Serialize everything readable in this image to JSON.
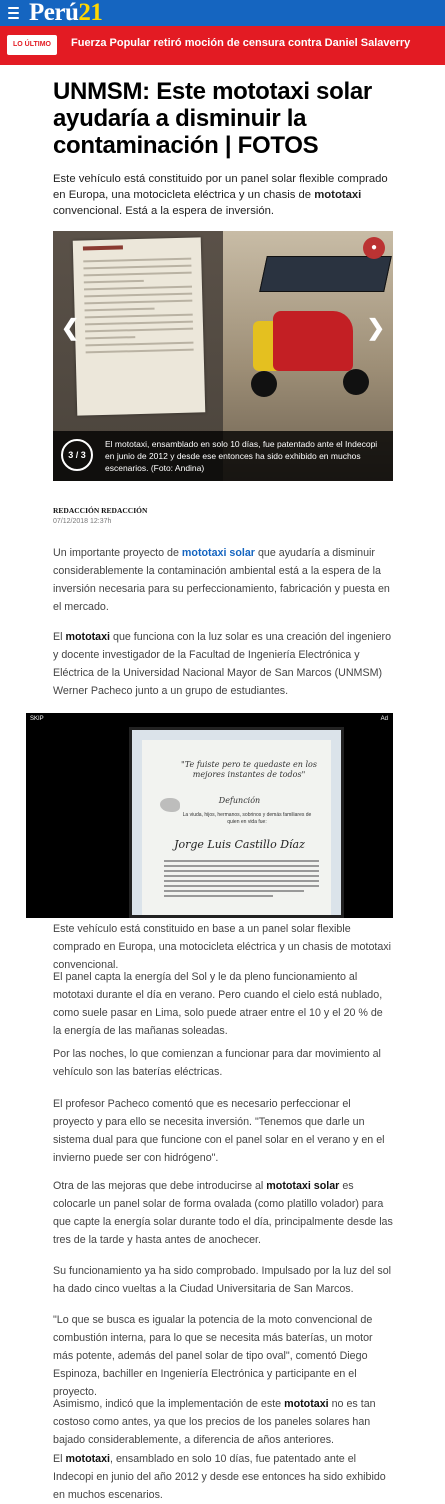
{
  "header": {
    "logo_main": "Perú",
    "logo_num": "21"
  },
  "ticker": {
    "badge": "LO ÚLTIMO",
    "headline": "Fuerza Popular retiró moción de censura contra Daniel Salaverry"
  },
  "article": {
    "title": "UNMSM: Este mototaxi solar ayudaría a disminuir la contaminación | FOTOS",
    "subtitle_a": "Este vehículo está constituido por un panel solar flexible comprado en Europa, una motocicleta eléctrica y un chasis de ",
    "subtitle_bold": "mototaxi",
    "subtitle_b": " convencional. Está a la espera de inversión.",
    "author": "REDACCIÓN REDACCIÓN",
    "date": "07/12/2018 12:37h"
  },
  "gallery": {
    "counter": "3 / 3",
    "caption": "El mototaxi, ensamblado en solo 10 días, fue patentado ante el Indecopi en junio de 2012 y desde ese entonces ha sido exhibido en muchos escenarios. (Foto: Andina)",
    "prev_icon": "chevron-left-icon",
    "next_icon": "chevron-right-icon"
  },
  "paragraphs": {
    "p1_a": "Un importante proyecto de ",
    "p1_link": "mototaxi solar",
    "p1_b": " que ayudaría a disminuir considerablemente la contaminación ambiental está a la espera de la inversión necesaria para su perfeccionamiento, fabricación y puesta en el mercado.",
    "p2_a": "El ",
    "p2_bold": "mototaxi",
    "p2_b": " que funciona con la luz solar es una creación del ingeniero y docente investigador de la Facultad de Ingeniería Electrónica y Eléctrica de la Universidad Nacional Mayor de San Marcos (UNMSM) Werner Pacheco junto a un grupo de estudiantes.",
    "p3": "Este vehículo está constituido en base a un panel solar flexible comprado en Europa, una motocicleta eléctrica y un chasis de mototaxi convencional.",
    "p4": "El panel capta la energía del Sol y le da pleno funcionamiento al mototaxi durante el día en verano. Pero cuando el cielo está nublado, como suele pasar en Lima, solo puede atraer entre el 10 y el 20 % de la energía de las mañanas soleadas.",
    "p5": "Por las noches, lo que comienzan a funcionar para dar movimiento al vehículo son las baterías eléctricas.",
    "p6": "El profesor Pacheco comentó que es necesario perfeccionar el proyecto y para ello se necesita inversión. \"Tenemos que darle un sistema dual para que funcione con el panel solar en el verano y en el invierno puede ser con hidrógeno\".",
    "p7_a": "Otra de las mejoras que debe introducirse al ",
    "p7_bold": "mototaxi solar",
    "p7_b": " es colocarle un panel solar de forma ovalada (como platillo volador) para que capte la energía solar durante todo el día, principalmente desde las tres de la tarde y hasta antes de anochecer.",
    "p8": "Su funcionamiento ya ha sido comprobado. Impulsado por la luz del sol ha dado cinco vueltas a la Ciudad Universitaria de San Marcos.",
    "p9": "\"Lo que se busca es igualar la potencia de la moto convencional de combustión interna, para lo que se necesita más baterías, un motor más potente, además del panel solar de tipo oval\", comentó Diego Espinoza, bachiller en Ingeniería Electrónica y participante en el proyecto.",
    "p10_a": "Asimismo, indicó que la implementación de este ",
    "p10_bold": "mototaxi",
    "p10_b": " no es tan costoso como antes, ya que los precios de los paneles solares han bajado considerablemente, a diferencia de años anteriores.",
    "p11_a": "El ",
    "p11_bold": "mototaxi",
    "p11_b": ", ensamblado en solo 10 días, fue patentado ante el Indecopi en junio del año 2012 y desde ese entonces ha sido exhibido en muchos escenarios."
  },
  "video": {
    "skip": "SKIP",
    "ad": "Ad",
    "quote": "\"Te fuiste pero te quedaste en los mejores instantes de todos\"",
    "heading": "Defunción",
    "family_line": "La viuda, hijos, hermanos, sobrinos y demás familiares de quien en vida fue:",
    "name": "Jorge Luis Castillo Díaz"
  },
  "colors": {
    "brand_blue": "#1565c0",
    "alert_red": "#e31b23",
    "logo_yellow": "#ffd600"
  }
}
